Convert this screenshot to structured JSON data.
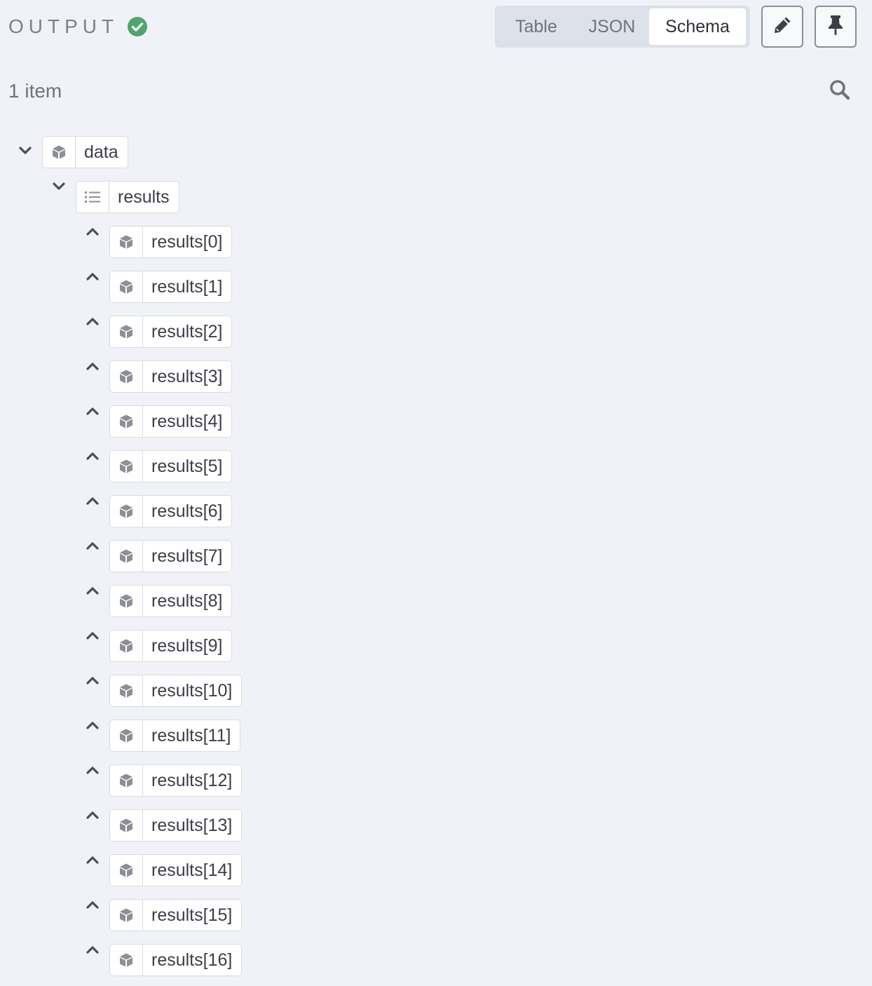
{
  "header": {
    "title": "OUTPUT",
    "status": "success",
    "views": [
      "Table",
      "JSON",
      "Schema"
    ],
    "active_view": "Schema"
  },
  "summary": {
    "item_count_label": "1 item"
  },
  "colors": {
    "success": "#4fa56d",
    "background": "#f0f2f7",
    "pill_border": "#d9dce3",
    "icon_gray": "#8b8f97"
  },
  "schema": {
    "root": {
      "label": "data",
      "type": "object",
      "expanded": true
    },
    "child": {
      "label": "results",
      "type": "array",
      "expanded": true
    },
    "items": [
      {
        "label": "results[0]",
        "type": "object",
        "expanded": false
      },
      {
        "label": "results[1]",
        "type": "object",
        "expanded": false
      },
      {
        "label": "results[2]",
        "type": "object",
        "expanded": false
      },
      {
        "label": "results[3]",
        "type": "object",
        "expanded": false
      },
      {
        "label": "results[4]",
        "type": "object",
        "expanded": false
      },
      {
        "label": "results[5]",
        "type": "object",
        "expanded": false
      },
      {
        "label": "results[6]",
        "type": "object",
        "expanded": false
      },
      {
        "label": "results[7]",
        "type": "object",
        "expanded": false
      },
      {
        "label": "results[8]",
        "type": "object",
        "expanded": false
      },
      {
        "label": "results[9]",
        "type": "object",
        "expanded": false
      },
      {
        "label": "results[10]",
        "type": "object",
        "expanded": false
      },
      {
        "label": "results[11]",
        "type": "object",
        "expanded": false
      },
      {
        "label": "results[12]",
        "type": "object",
        "expanded": false
      },
      {
        "label": "results[13]",
        "type": "object",
        "expanded": false
      },
      {
        "label": "results[14]",
        "type": "object",
        "expanded": false
      },
      {
        "label": "results[15]",
        "type": "object",
        "expanded": false
      },
      {
        "label": "results[16]",
        "type": "object",
        "expanded": false
      }
    ]
  },
  "icons": {
    "status": "check-circle-icon",
    "edit": "pencil-icon",
    "pin": "pin-icon",
    "search": "search-icon",
    "object": "cube-icon",
    "array": "list-icon",
    "expanded": "chevron-down-icon",
    "collapsed": "chevron-up-icon"
  }
}
